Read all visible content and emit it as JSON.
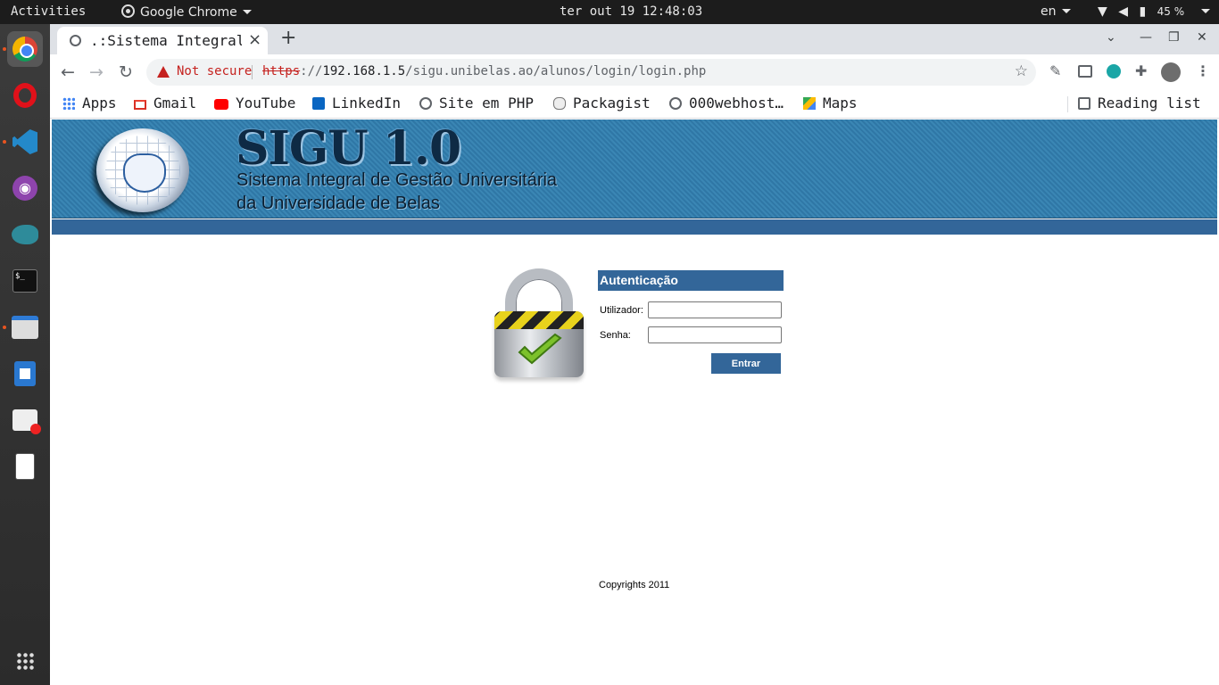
{
  "topbar": {
    "activities": "Activities",
    "app_name": "Google Chrome",
    "clock": "ter out 19 12:48:03",
    "language": "en",
    "battery": "45 %"
  },
  "dock": {
    "apps": [
      "chrome-icon",
      "opera-icon",
      "vscode-icon",
      "github-desktop-icon",
      "mysql-workbench-icon",
      "terminal-icon",
      "files-icon",
      "libreoffice-writer-icon",
      "software-store-icon",
      "usb-drive-icon",
      "show-applications-icon"
    ]
  },
  "browser": {
    "tab_title": ".:Sistema Integral de Gestão Universitária",
    "security_label": "Not secure",
    "url_scheme": "https",
    "url_sep": "://",
    "url_host": "192.168.1.5",
    "url_path": "/sigu.unibelas.ao/alunos/login/login.php",
    "bookmarks": [
      "Apps",
      "Gmail",
      "YouTube",
      "LinkedIn",
      "Site em PHP",
      "Packagist",
      "000webhost…",
      "Maps"
    ],
    "reading_list": "Reading list"
  },
  "page": {
    "banner_title": "SIGU 1.0",
    "banner_subtitle_1": "Sistema Integral de Gestão Universitária",
    "banner_subtitle_2": "da Universidade de Belas",
    "auth_heading": "Autenticação",
    "user_label": "Utilizador:",
    "user_value": "",
    "password_label": "Senha:",
    "password_value": "",
    "submit_label": "Entrar",
    "copyright": "Copyrights 2011"
  },
  "colors": {
    "accent": "#336699",
    "banner": "#3a86b4",
    "warning": "#c5221f"
  }
}
